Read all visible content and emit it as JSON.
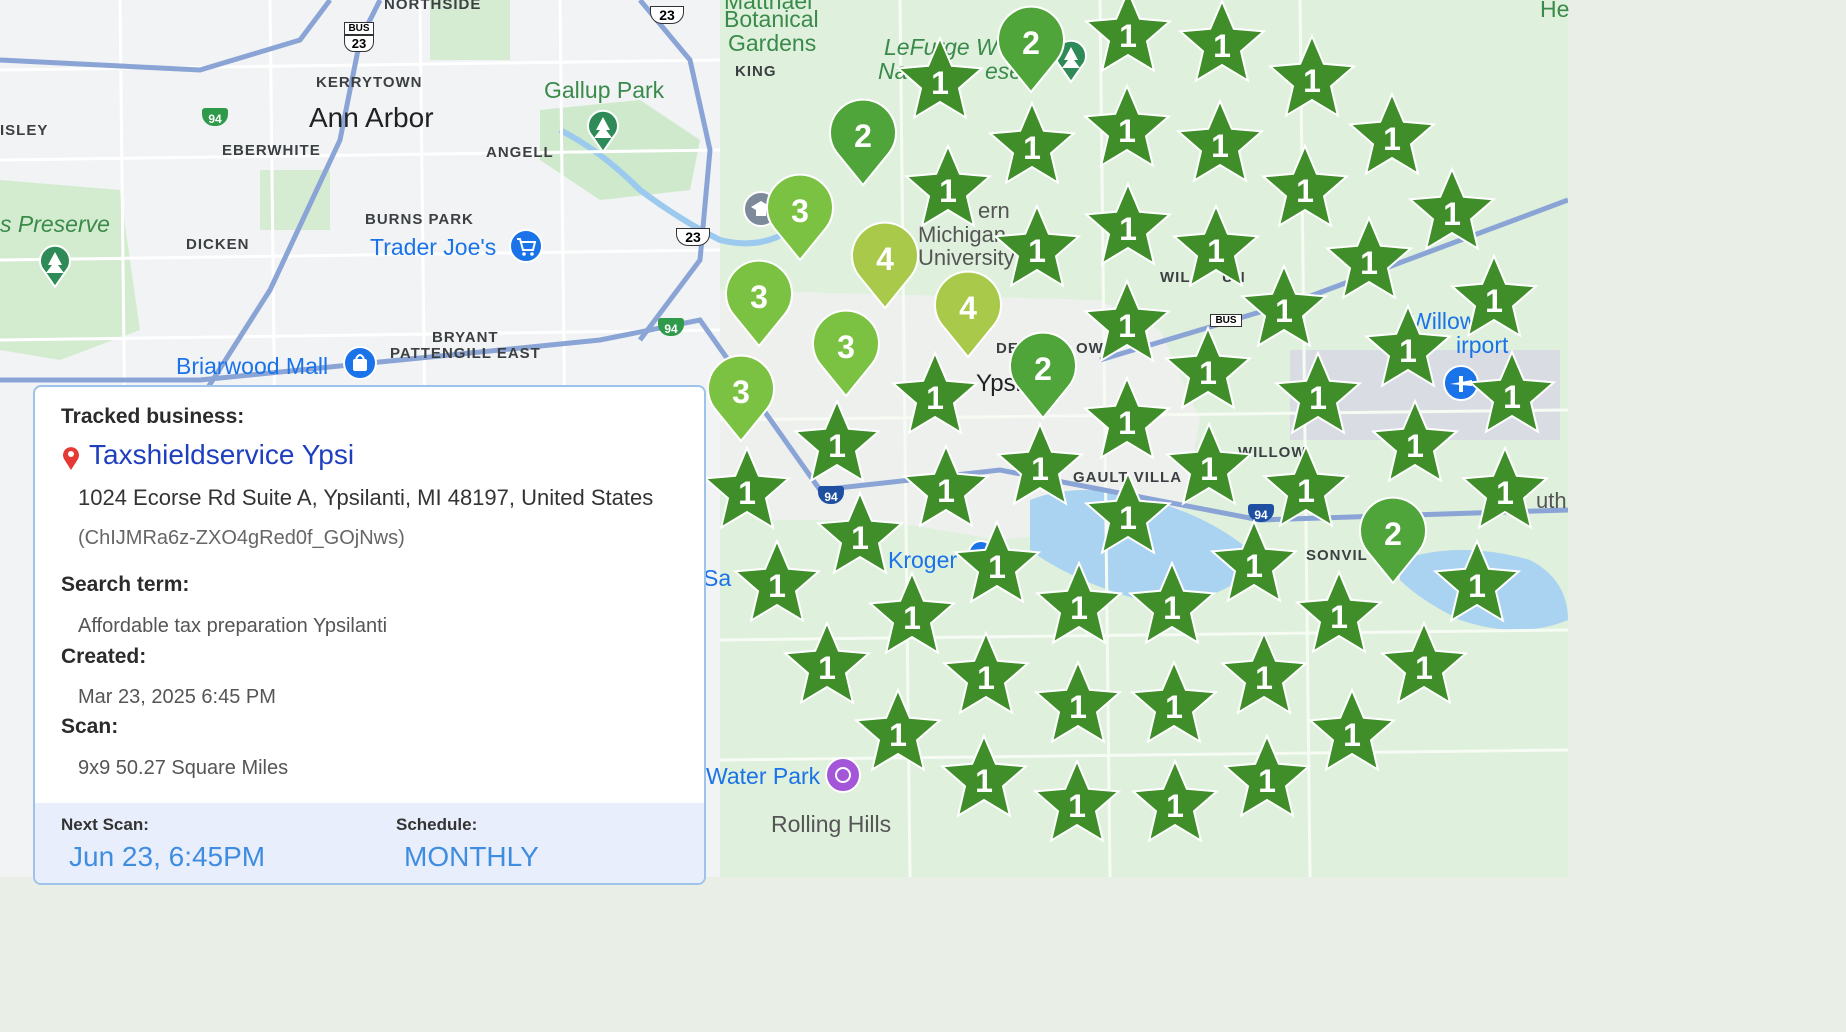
{
  "map": {
    "labels": {
      "northside": "NORTHSIDE",
      "kerrytown": "KERRYTOWN",
      "ann_arbor": "Ann Arbor",
      "eberwhite": "EBERWHITE",
      "angell": "ANGELL",
      "isley": "ISLEY",
      "burns_park": "BURNS PARK",
      "dicken": "DICKEN",
      "preserve": "s Preserve",
      "trader_joes": "Trader Joe's",
      "bryant": "BRYANT",
      "pattengill": "PATTENGILL EAST",
      "briarwood": "Briarwood Mall",
      "gallup_park": "Gallup Park",
      "botanical": "Botanical",
      "gardens": "Gardens",
      "matthaei": "Matthaei",
      "king": "KING",
      "lefurge_1": "LeFurge W",
      "lefurge_2": "Na",
      "lefurge_3": "ese",
      "eastern_1": "ern",
      "eastern_2": "Michigan",
      "eastern_3": "University",
      "will": "WIL",
      "run": "UN",
      "downtown_1": "DE",
      "downtown_2": "OWN",
      "ypsi": "Ypsi",
      "gault": "GAULT VILLA",
      "willow_run": "WILLOW",
      "willow_airport_1": "Willow",
      "willow_airport_2": "irport",
      "belleville": "SONVIL",
      "kroger": "Kroger",
      "sa": "Sa",
      "water_park": "Water Park",
      "rolling_hills": "Rolling Hills",
      "he": "He",
      "uth": "uth"
    },
    "shields": {
      "us23": "23",
      "bus": "BUS",
      "i94": "94"
    }
  },
  "markers": {
    "stars": [
      {
        "rank": "1"
      },
      {
        "rank": "1"
      },
      {
        "rank": "1"
      },
      {
        "rank": "1"
      },
      {
        "rank": "1"
      },
      {
        "rank": "1"
      },
      {
        "rank": "1"
      },
      {
        "rank": "1"
      },
      {
        "rank": "1"
      },
      {
        "rank": "1"
      },
      {
        "rank": "1"
      },
      {
        "rank": "1"
      },
      {
        "rank": "1"
      },
      {
        "rank": "1"
      },
      {
        "rank": "1"
      },
      {
        "rank": "1"
      },
      {
        "rank": "1"
      },
      {
        "rank": "1"
      },
      {
        "rank": "1"
      },
      {
        "rank": "1"
      },
      {
        "rank": "1"
      },
      {
        "rank": "1"
      },
      {
        "rank": "1"
      },
      {
        "rank": "1"
      },
      {
        "rank": "1"
      },
      {
        "rank": "1"
      },
      {
        "rank": "1"
      },
      {
        "rank": "1"
      },
      {
        "rank": "1"
      },
      {
        "rank": "1"
      },
      {
        "rank": "1"
      },
      {
        "rank": "1"
      },
      {
        "rank": "1"
      },
      {
        "rank": "1"
      },
      {
        "rank": "1"
      },
      {
        "rank": "1"
      },
      {
        "rank": "1"
      },
      {
        "rank": "1"
      },
      {
        "rank": "1"
      },
      {
        "rank": "1"
      },
      {
        "rank": "1"
      },
      {
        "rank": "1"
      },
      {
        "rank": "1"
      },
      {
        "rank": "1"
      },
      {
        "rank": "1"
      },
      {
        "rank": "1"
      },
      {
        "rank": "1"
      },
      {
        "rank": "1"
      },
      {
        "rank": "1"
      },
      {
        "rank": "1"
      },
      {
        "rank": "1"
      },
      {
        "rank": "1"
      },
      {
        "rank": "1"
      },
      {
        "rank": "1"
      },
      {
        "rank": "1"
      },
      {
        "rank": "1"
      },
      {
        "rank": "1"
      },
      {
        "rank": "1"
      },
      {
        "rank": "1"
      },
      {
        "rank": "1"
      },
      {
        "rank": "1"
      },
      {
        "rank": "1"
      },
      {
        "rank": "1"
      },
      {
        "rank": "1"
      },
      {
        "rank": "1"
      },
      {
        "rank": "1"
      },
      {
        "rank": "1"
      }
    ],
    "pins": [
      {
        "rank": "2"
      },
      {
        "rank": "2"
      },
      {
        "rank": "2"
      },
      {
        "rank": "2"
      },
      {
        "rank": "3"
      },
      {
        "rank": "3"
      },
      {
        "rank": "3"
      },
      {
        "rank": "3"
      },
      {
        "rank": "4"
      },
      {
        "rank": "4"
      }
    ],
    "colors": {
      "rank1": "#3f8e2a",
      "rank2": "#4fa43a",
      "rank3": "#7cc242",
      "rank4": "#a8c94a"
    }
  },
  "card": {
    "tracked_label": "Tracked business:",
    "business_name": "Taxshieldservice Ypsi",
    "address": "1024 Ecorse Rd Suite A, Ypsilanti, MI 48197, United States",
    "place_id": "(ChIJMRa6z-ZXO4gRed0f_GOjNws)",
    "search_label": "Search term:",
    "search_value": "Affordable tax preparation Ypsilanti",
    "created_label": "Created:",
    "created_value": "Mar 23, 2025 6:45 PM",
    "scan_label": "Scan:",
    "scan_value": "9x9 50.27 Square Miles",
    "next_scan_label": "Next Scan:",
    "next_scan_value": "Jun 23, 6:45PM",
    "schedule_label": "Schedule:",
    "schedule_value": "MONTHLY"
  }
}
